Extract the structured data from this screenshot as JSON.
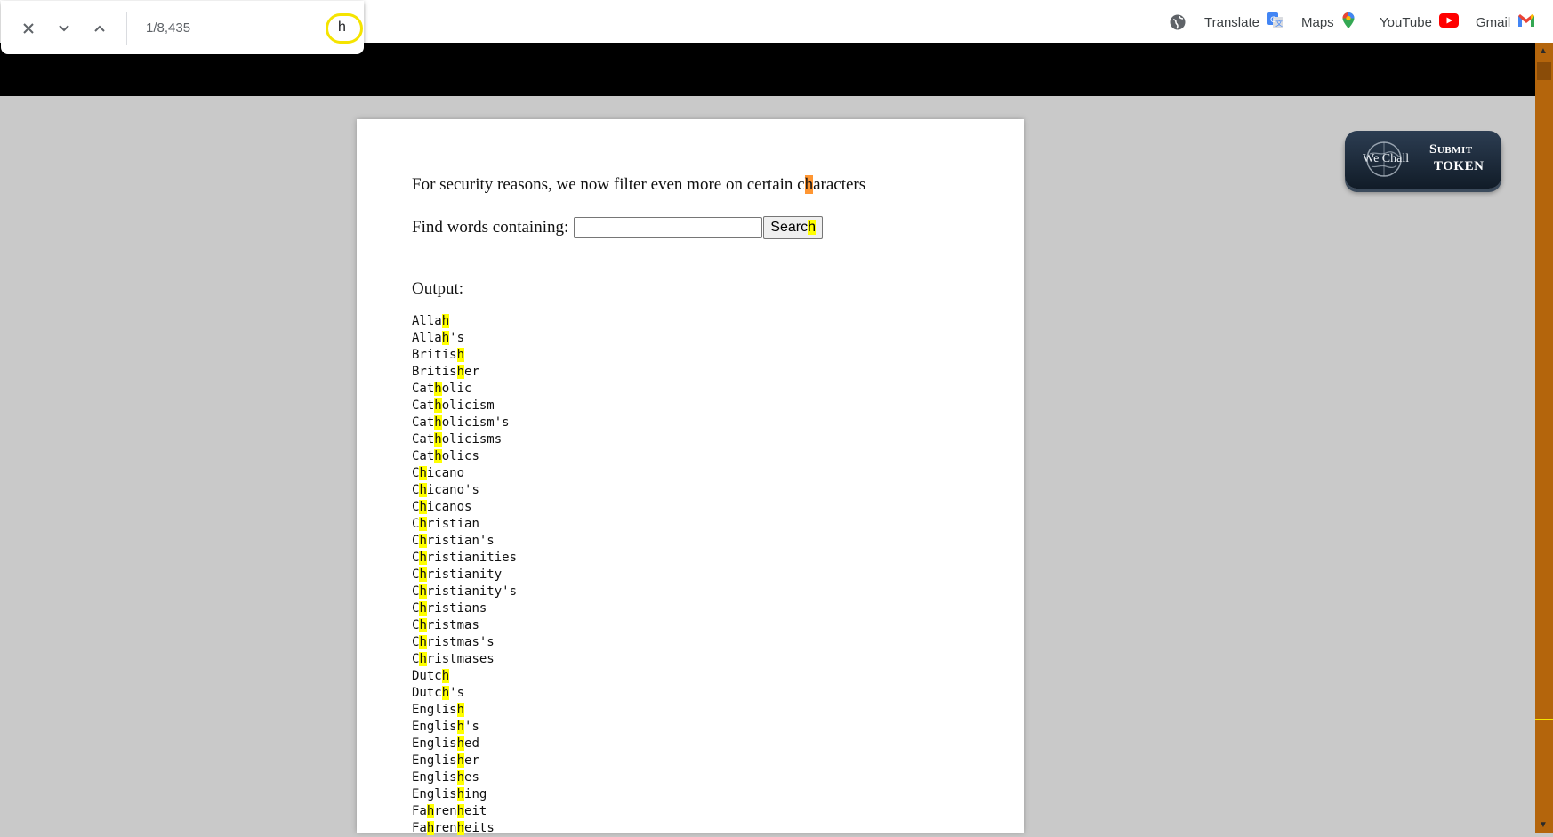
{
  "find_bar": {
    "match_count": "1/8,435",
    "query": "h"
  },
  "bookmarks": [
    {
      "label": "Translate",
      "icon": "google-translate-icon"
    },
    {
      "label": "Maps",
      "icon": "google-maps-icon"
    },
    {
      "label": "YouTube",
      "icon": "youtube-icon"
    },
    {
      "label": "Gmail",
      "icon": "gmail-icon"
    }
  ],
  "page": {
    "intro_before": "For security reasons, we now filter even more on certain c",
    "intro_match": "h",
    "intro_after": "aracters",
    "find_label": "Find words containing:",
    "search_input_value": "",
    "search_button_before": "Searc",
    "search_button_match": "h",
    "output_label": "Output:"
  },
  "words": [
    [
      "Alla",
      "h",
      ""
    ],
    [
      "Alla",
      "h",
      "'s"
    ],
    [
      "Britis",
      "h",
      ""
    ],
    [
      "Britis",
      "h",
      "er"
    ],
    [
      "Cat",
      "h",
      "olic"
    ],
    [
      "Cat",
      "h",
      "olicism"
    ],
    [
      "Cat",
      "h",
      "olicism's"
    ],
    [
      "Cat",
      "h",
      "olicisms"
    ],
    [
      "Cat",
      "h",
      "olics"
    ],
    [
      "C",
      "h",
      "icano"
    ],
    [
      "C",
      "h",
      "icano's"
    ],
    [
      "C",
      "h",
      "icanos"
    ],
    [
      "C",
      "h",
      "ristian"
    ],
    [
      "C",
      "h",
      "ristian's"
    ],
    [
      "C",
      "h",
      "ristianities"
    ],
    [
      "C",
      "h",
      "ristianity"
    ],
    [
      "C",
      "h",
      "ristianity's"
    ],
    [
      "C",
      "h",
      "ristians"
    ],
    [
      "C",
      "h",
      "ristmas"
    ],
    [
      "C",
      "h",
      "ristmas's"
    ],
    [
      "C",
      "h",
      "ristmases"
    ],
    [
      "Dutc",
      "h",
      ""
    ],
    [
      "Dutc",
      "h",
      "'s"
    ],
    [
      "Englis",
      "h",
      ""
    ],
    [
      "Englis",
      "h",
      "'s"
    ],
    [
      "Englis",
      "h",
      "ed"
    ],
    [
      "Englis",
      "h",
      "er"
    ],
    [
      "Englis",
      "h",
      "es"
    ],
    [
      "Englis",
      "h",
      "ing"
    ],
    [
      "Fa",
      "h",
      "ren",
      "h",
      "eit"
    ],
    [
      "Fa",
      "h",
      "ren",
      "h",
      "eits"
    ]
  ],
  "token_badge": {
    "logo_text": "We Chall",
    "line1": "Submit",
    "line2": "TOKEN"
  },
  "colors": {
    "highlight": "#ffff00",
    "current_match": "#ff9632",
    "scrollbar": "#b4650c",
    "page_background": "#c9c9c9"
  }
}
